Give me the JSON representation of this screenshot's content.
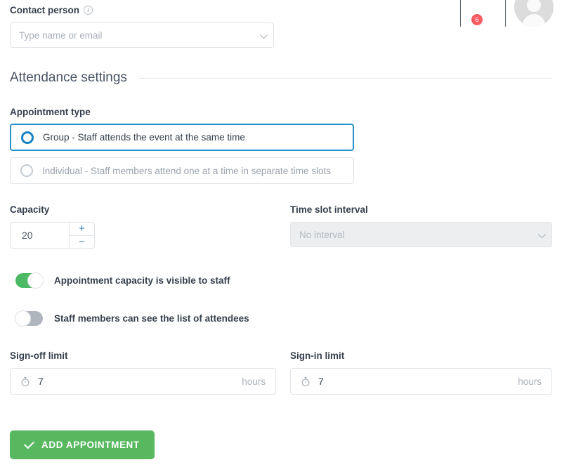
{
  "header": {
    "notification_badge_count": "6",
    "avatar_name": "user-avatar"
  },
  "contact": {
    "label": "Contact person",
    "info_icon": "info-icon",
    "placeholder": "Type name or email",
    "value": ""
  },
  "section": {
    "title": "Attendance settings"
  },
  "appointment_type": {
    "label": "Appointment type",
    "options": [
      {
        "label": "Group - Staff attends the event at the same time",
        "selected": true,
        "disabled": false
      },
      {
        "label": "Individual - Staff members attend one at a time in separate time slots",
        "selected": false,
        "disabled": true
      }
    ]
  },
  "capacity": {
    "label": "Capacity",
    "value": "20",
    "increment_label": "+",
    "decrement_label": "−"
  },
  "time_slot_interval": {
    "label": "Time slot interval",
    "value": "No interval",
    "disabled": true
  },
  "toggles": [
    {
      "label": "Appointment capacity is visible to staff",
      "state": "on"
    },
    {
      "label": "Staff members can see the list of attendees",
      "state": "off"
    }
  ],
  "sign_off_limit": {
    "label": "Sign-off limit",
    "value": "7",
    "unit": "hours",
    "icon": "stopwatch-icon"
  },
  "sign_in_limit": {
    "label": "Sign-in limit",
    "value": "7",
    "unit": "hours",
    "icon": "stopwatch-icon"
  },
  "submit": {
    "label": "ADD APPOINTMENT",
    "icon": "check-icon"
  },
  "colors": {
    "accent_blue": "#1782c4",
    "selected_border": "#2b8fcc",
    "green": "#57b85f",
    "toggle_green": "#4cb964",
    "badge_red": "#fb5d62",
    "text": "#36404d",
    "muted": "#9aa2ad"
  }
}
